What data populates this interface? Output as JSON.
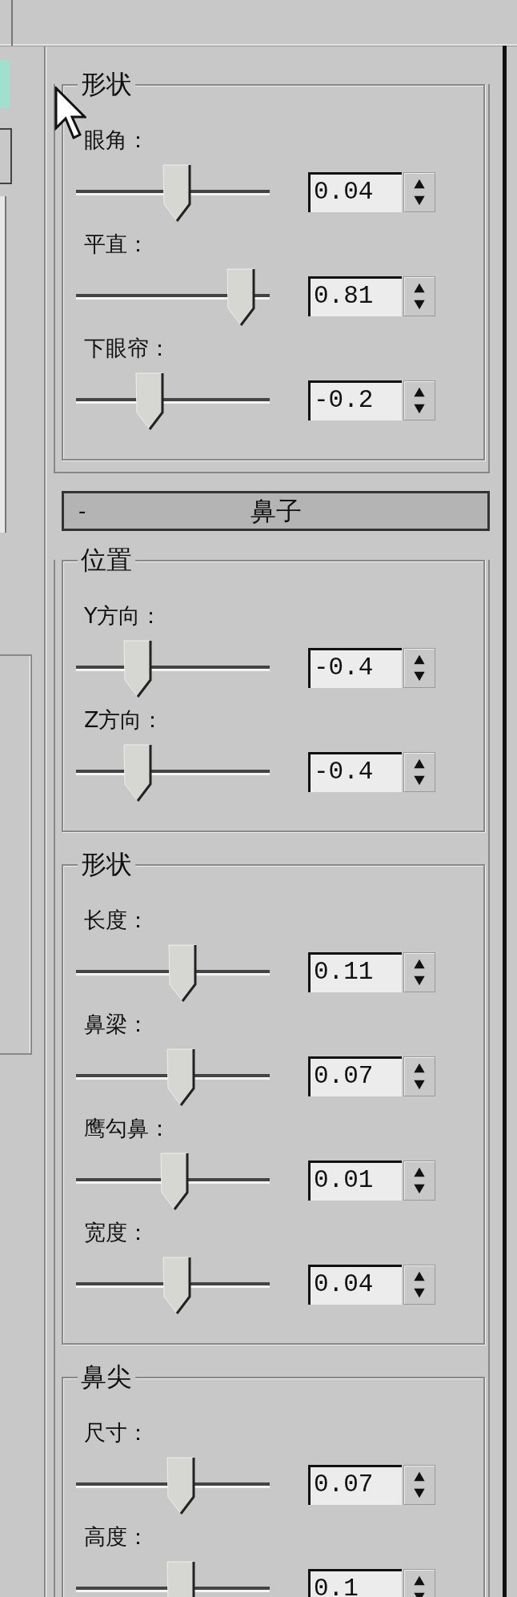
{
  "upper_groups": [
    {
      "title": "形状",
      "sliders": [
        {
          "label": "眼角：",
          "level": 0.52,
          "value": "0.04"
        },
        {
          "label": "平直：",
          "level": 0.85,
          "value": "0.81"
        },
        {
          "label": "下眼帘：",
          "level": 0.38,
          "value": "-0.2"
        }
      ]
    }
  ],
  "rollout": {
    "toggle": "-",
    "title": "鼻子",
    "groups": [
      {
        "title": "位置",
        "sliders": [
          {
            "label": "Y方向：",
            "level": 0.32,
            "value": "-0.4"
          },
          {
            "label": "Z方向：",
            "level": 0.32,
            "value": "-0.4"
          }
        ]
      },
      {
        "title": "形状",
        "sliders": [
          {
            "label": "长度：",
            "level": 0.55,
            "value": "0.11"
          },
          {
            "label": "鼻梁：",
            "level": 0.54,
            "value": "0.07"
          },
          {
            "label": "鹰勾鼻：",
            "level": 0.51,
            "value": "0.01"
          },
          {
            "label": "宽度：",
            "level": 0.52,
            "value": "0.04"
          }
        ]
      },
      {
        "title": "鼻尖",
        "sliders": [
          {
            "label": "尺寸：",
            "level": 0.54,
            "value": "0.07"
          },
          {
            "label": "高度：",
            "level": 0.54,
            "value": "0.1"
          }
        ]
      }
    ]
  }
}
